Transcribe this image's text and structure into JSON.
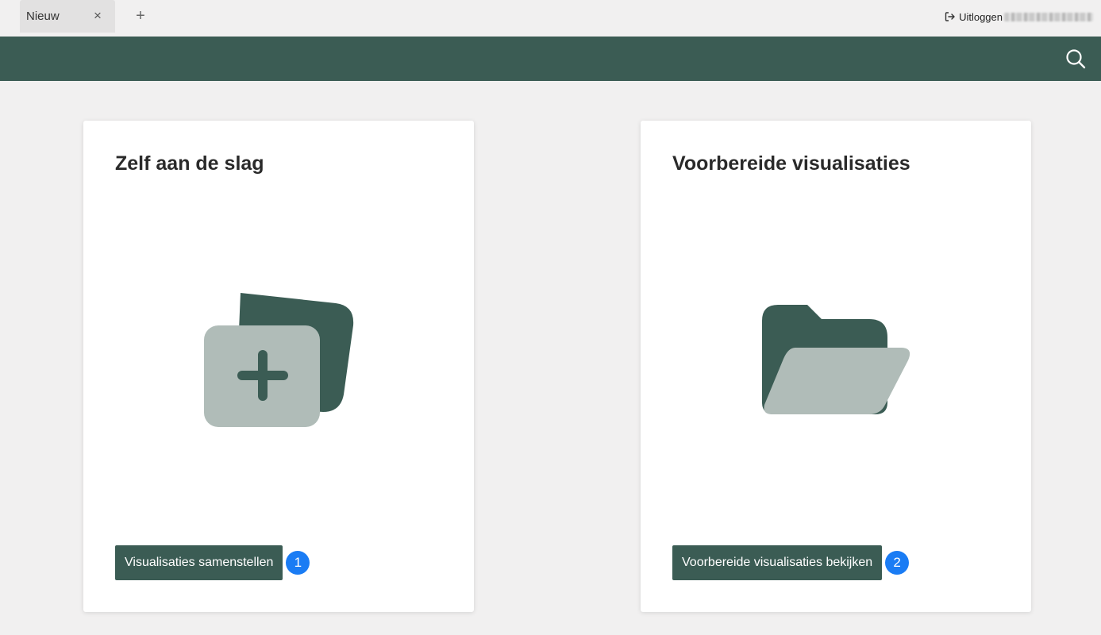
{
  "tabs": [
    {
      "label": "Nieuw",
      "close_glyph": "×"
    }
  ],
  "tab_add_glyph": "+",
  "account": {
    "logout_label": "Uitloggen",
    "logout_icon": "logout-icon"
  },
  "header": {
    "search_icon": "search-icon",
    "background": "#3b5c54"
  },
  "cards": [
    {
      "title": "Zelf aan de slag",
      "icon": "add-files-icon",
      "button_label": "Visualisaties samenstellen",
      "step": "1"
    },
    {
      "title": "Voorbereide visualisaties",
      "icon": "open-folder-icon",
      "button_label": "Voorbereide visualisaties bekijken",
      "step": "2"
    }
  ],
  "colors": {
    "accent": "#3b5c54",
    "icon_light": "#b0bcb8",
    "step_badge": "#1a7cf4",
    "page_background": "#f1f0f0"
  }
}
